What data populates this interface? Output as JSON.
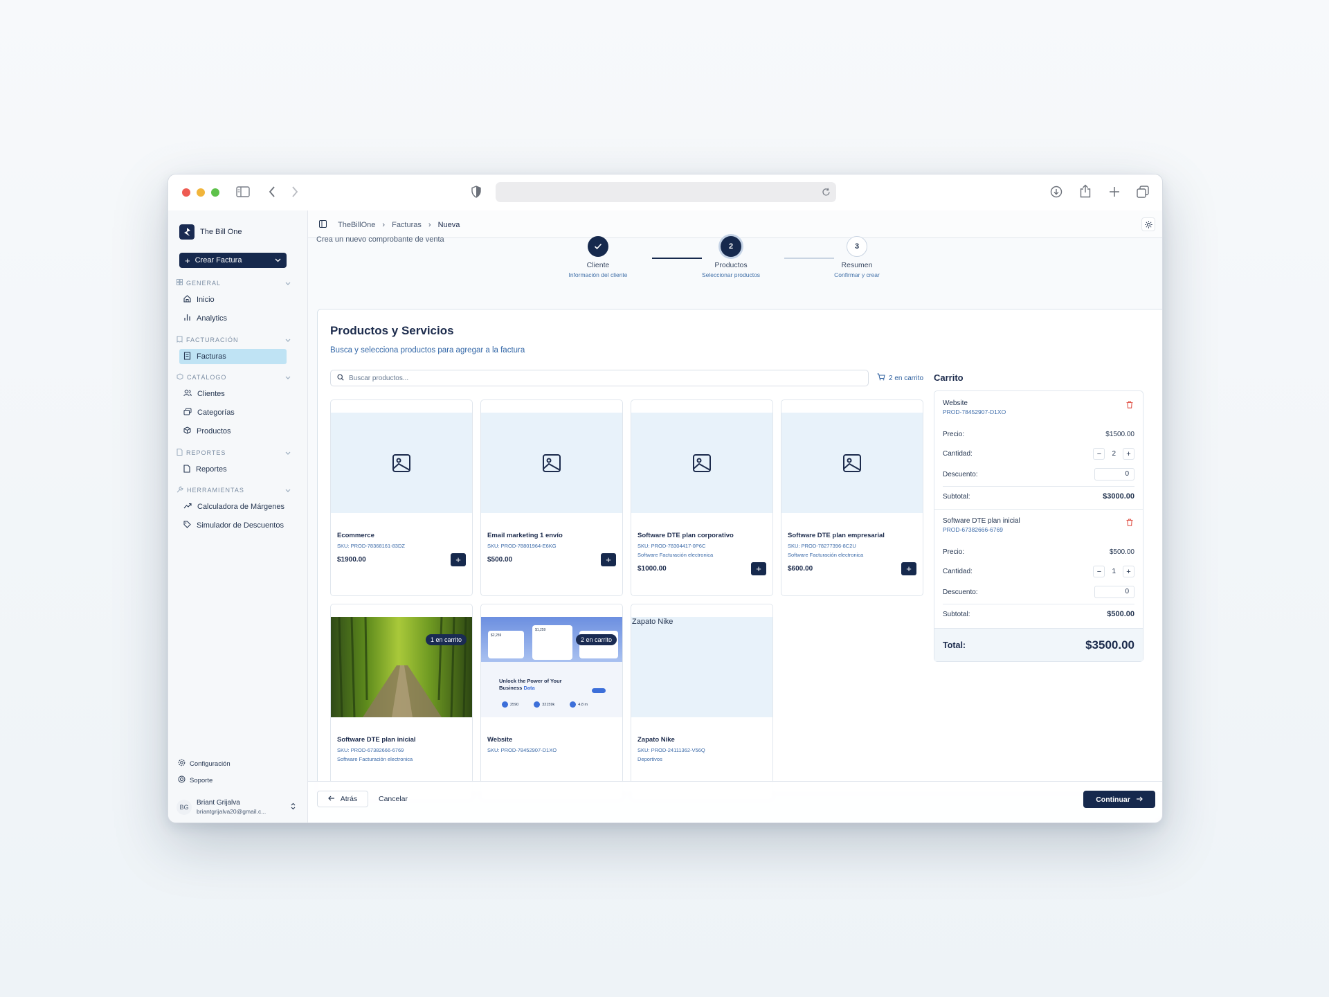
{
  "app": {
    "brand": "The Bill One",
    "create_button": "Crear Factura"
  },
  "sidebar": {
    "sections": [
      {
        "title": "GENERAL",
        "items": [
          "Inicio",
          "Analytics"
        ]
      },
      {
        "title": "FACTURACIÓN",
        "items": [
          "Facturas"
        ]
      },
      {
        "title": "CATÁLOGO",
        "items": [
          "Clientes",
          "Categorías",
          "Productos"
        ]
      },
      {
        "title": "REPORTES",
        "items": [
          "Reportes"
        ]
      },
      {
        "title": "HERRAMIENTAS",
        "items": [
          "Calculadora de Márgenes",
          "Simulador de Descuentos"
        ]
      }
    ],
    "footer": {
      "config": "Configuración",
      "support": "Soporte"
    },
    "user": {
      "initials": "BG",
      "name": "Briant Grijalva",
      "email": "briantgrijalva20@gmail.c..."
    }
  },
  "breadcrumb": [
    "TheBillOne",
    "Facturas",
    "Nueva"
  ],
  "subtitle": "Crea un nuevo comprobante de venta",
  "steps": [
    {
      "number": "1",
      "title": "Cliente",
      "desc": "Información del cliente"
    },
    {
      "number": "2",
      "title": "Productos",
      "desc": "Seleccionar productos"
    },
    {
      "number": "3",
      "title": "Resumen",
      "desc": "Confirmar y crear"
    }
  ],
  "products_section": {
    "title": "Productos y Servicios",
    "desc": "Busca y selecciona productos para agregar a la factura",
    "search_placeholder": "Buscar productos...",
    "cart_count": "2 en carrito"
  },
  "products": [
    {
      "name": "Ecommerce",
      "sku": "SKU: PROD-78368161-83DZ",
      "category": "",
      "price": "$1900.00"
    },
    {
      "name": "Email marketing 1 envío",
      "sku": "SKU: PROD-78801964-E6KG",
      "category": "",
      "price": "$500.00"
    },
    {
      "name": "Software DTE plan corporativo",
      "sku": "SKU: PROD-78304417-0P6C",
      "category": "Software Facturación electronica",
      "price": "$1000.00"
    },
    {
      "name": "Software DTE plan empresarial",
      "sku": "SKU: PROD-78277396-8C2U",
      "category": "Software Facturación electronica",
      "price": "$600.00"
    },
    {
      "name": "Software DTE plan inicial",
      "sku": "SKU: PROD-67382666-6769",
      "category": "Software Facturación electronica",
      "badge": "1 en carrito"
    },
    {
      "name": "Website",
      "sku": "SKU: PROD-78452907-D1XO",
      "category": "",
      "badge": "2 en carrito"
    },
    {
      "name": "Zapato Nike",
      "sku": "SKU: PROD-24111362-V56Q",
      "category": "Deportivos",
      "img_alt": "Zapato Nike"
    }
  ],
  "website_thumb": {
    "headline1": "Unlock the Power of Your",
    "headline2": "Business",
    "accent": "Data",
    "stat1": "$2,259",
    "stat2": "$1,259",
    "stat3": "2590",
    "stat4": "32159k",
    "stat5": "4.8 m"
  },
  "cart": {
    "title": "Carrito",
    "labels": {
      "price": "Precio:",
      "qty": "Cantidad:",
      "discount": "Descuento:",
      "subtotal": "Subtotal:"
    },
    "items": [
      {
        "name": "Website",
        "code": "PROD-78452907-D1XO",
        "price": "$1500.00",
        "qty": "2",
        "discount": "0",
        "subtotal": "$3000.00"
      },
      {
        "name": "Software DTE plan inicial",
        "code": "PROD-67382666-6769",
        "price": "$500.00",
        "qty": "1",
        "discount": "0",
        "subtotal": "$500.00"
      }
    ],
    "total_label": "Total:",
    "total": "$3500.00"
  },
  "footer_bar": {
    "back": "Atrás",
    "cancel": "Cancelar",
    "continue": "Continuar"
  },
  "colors": {
    "primary": "#16294d",
    "active_nav": "#bfe3f4",
    "accent_blue": "#3065a6",
    "danger": "#e0554a"
  }
}
